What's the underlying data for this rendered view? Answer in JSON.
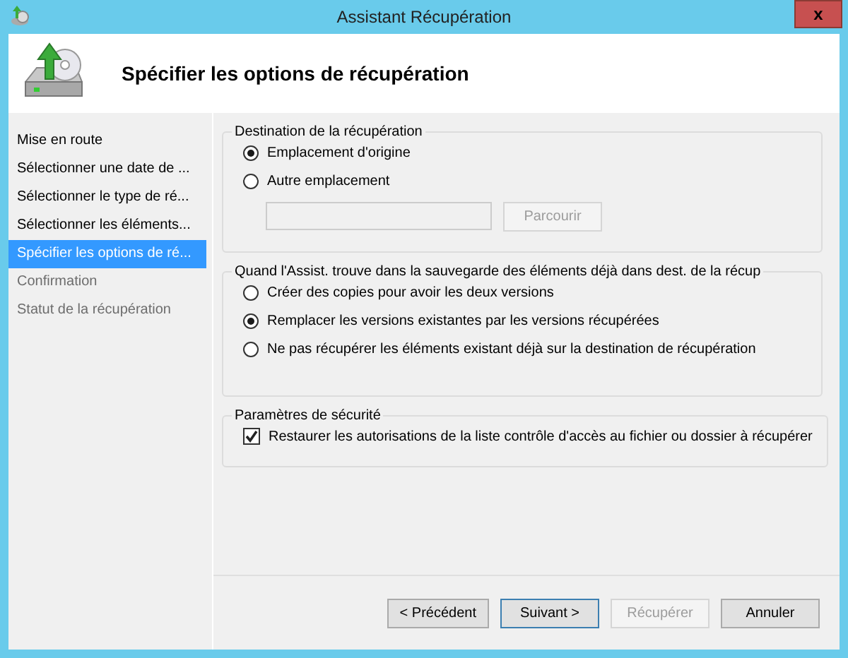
{
  "window": {
    "title": "Assistant Récupération",
    "close": "x"
  },
  "header": {
    "title": "Spécifier les options de récupération"
  },
  "sidebar": {
    "items": [
      {
        "label": "Mise en route",
        "selected": false,
        "disabled": false
      },
      {
        "label": "Sélectionner une date de ...",
        "selected": false,
        "disabled": false
      },
      {
        "label": "Sélectionner le type de ré...",
        "selected": false,
        "disabled": false
      },
      {
        "label": "Sélectionner les éléments...",
        "selected": false,
        "disabled": false
      },
      {
        "label": "Spécifier les options de ré...",
        "selected": true,
        "disabled": false
      },
      {
        "label": "Confirmation",
        "selected": false,
        "disabled": true
      },
      {
        "label": "Statut de la récupération",
        "selected": false,
        "disabled": true
      }
    ]
  },
  "groups": [
    {
      "title": "Destination de la récupération",
      "items": [
        {
          "kind": "radio",
          "label": "Emplacement d'origine",
          "selected": true
        },
        {
          "kind": "radio",
          "label": "Autre emplacement",
          "selected": false
        },
        {
          "kind": "path",
          "browse": "Parcourir",
          "disabled": true
        }
      ]
    },
    {
      "title": "Quand l'Assist. trouve dans la sauvegarde des éléments déjà dans dest. de la récup",
      "items": [
        {
          "kind": "radio",
          "label": "Créer des copies pour avoir les deux versions",
          "selected": false
        },
        {
          "kind": "radio",
          "label": "Remplacer les versions existantes par les versions récupérées",
          "selected": true
        },
        {
          "kind": "radio",
          "label": "Ne pas récupérer les éléments existant déjà sur la destination de récupération",
          "selected": false
        }
      ]
    },
    {
      "title": "Paramètres de sécurité",
      "items": [
        {
          "kind": "checkbox",
          "label": "Restaurer les autorisations de la liste contrôle d'accès au fichier ou dossier à récupérer",
          "checked": true
        }
      ]
    }
  ],
  "buttons": [
    {
      "label": "< Précédent",
      "disabled": false,
      "focused": false
    },
    {
      "label": "Suivant >",
      "disabled": false,
      "focused": true
    },
    {
      "label": "Récupérer",
      "disabled": true,
      "focused": false
    },
    {
      "label": "Annuler",
      "disabled": false,
      "focused": false
    }
  ]
}
